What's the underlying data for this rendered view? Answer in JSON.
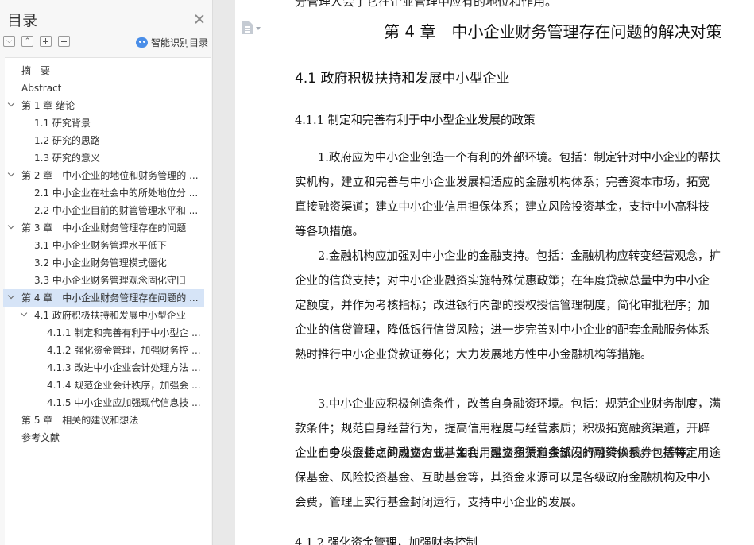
{
  "sidebar": {
    "title": "目录",
    "smart_label": "智能识别目录",
    "toc": [
      {
        "label": "摘　要",
        "level": 0,
        "expandable": false
      },
      {
        "label": "Abstract",
        "level": 0,
        "expandable": false
      },
      {
        "label": "第 1 章  绪论",
        "level": 0,
        "expandable": true
      },
      {
        "label": "1.1 研究背景",
        "level": 1,
        "expandable": false
      },
      {
        "label": "1.2 研究的思路",
        "level": 1,
        "expandable": false
      },
      {
        "label": "1.3 研究的意义",
        "level": 1,
        "expandable": false
      },
      {
        "label": "第 2 章　中小企业的地位和财务管理的 ...",
        "level": 0,
        "expandable": true
      },
      {
        "label": "2.1 中小企业在社会中的所处地位分 ...",
        "level": 1,
        "expandable": false
      },
      {
        "label": "2.2 中小企业目前的财管管理水平和 ...",
        "level": 1,
        "expandable": false
      },
      {
        "label": "第 3 章　中小企业财务管理存在的问题",
        "level": 0,
        "expandable": true
      },
      {
        "label": "3.1 中小企业财务管理水平低下",
        "level": 1,
        "expandable": false
      },
      {
        "label": "3.2 中小企业财务管理模式僵化",
        "level": 1,
        "expandable": false
      },
      {
        "label": "3.3 中小企业财务管理观念固化守旧",
        "level": 1,
        "expandable": false
      },
      {
        "label": "第 4 章　中小企业财务管理存在问题的 ...",
        "level": 0,
        "expandable": true,
        "selected": true
      },
      {
        "label": "4.1 政府积极扶持和发展中小型企业",
        "level": 1,
        "expandable": true
      },
      {
        "label": "4.1.1 制定和完善有利于中小型企 ...",
        "level": 2,
        "expandable": false
      },
      {
        "label": "4.1.2 强化资金管理，加强财务控 ...",
        "level": 2,
        "expandable": false
      },
      {
        "label": "4.1.3 改进中小企业会计处理方法 ...",
        "level": 2,
        "expandable": false
      },
      {
        "label": "4.1.4  规范企业会计秩序，加强会 ...",
        "level": 2,
        "expandable": false
      },
      {
        "label": "4.1.5 中小企业应加强现代信息技 ...",
        "level": 2,
        "expandable": false
      },
      {
        "label": "第 5 章　相关的建议和想法",
        "level": 0,
        "expandable": false
      },
      {
        "label": "参考文献",
        "level": 0,
        "expandable": false
      }
    ]
  },
  "document": {
    "top_cut_line": "分管理人会了它在企业管理中应有的地位和作用。",
    "chapter_title": "第 4 章　中小企业财务管理存在问题的解决对策",
    "section_title": "4.1 政府积极扶持和发展中小型企业",
    "subsection_title": "4.1.1 制定和完善有利于中小型企业发展的政策",
    "paragraphs": [
      [
        "1.政府应为中小企业创造一个有利的外部环境。包括：制定针对中小企业的帮扶",
        "实机构，建立和完善与中小企业发展相适应的金融机构体系；完善资本市场，拓宽",
        "直接融资渠道；建立中小企业信用担保体系；建立风险投资基金，支持中小高科技",
        "等各项措施。"
      ],
      [
        "2.金融机构应加强对中小企业的金融支持。包括：金融机构应转变经营观念，扩",
        "企业的信贷支持；对中小企业融资实施特殊优惠政策；在年度贷款总量中为中小企",
        "定额度，并作为考核指标；改进银行内部的授权授信管理制度，简化审批程序；加",
        "企业的信贷管理，降低银行信贷风险；进一步完善对中小企业的配套金融服务体系",
        "熟时推行中小企业贷款证券化；大力发展地方性中小金融机构等措施。"
      ],
      [
        "3.中小企业应积极创造条件，改善自身融资环境。包括：规范企业财务制度，满",
        "款条件；规范自身经营行为，提高信用程度与经营素质；积极拓宽融资渠道，开辟",
        "企业自身发展特点的融资方式，如利用融资租赁和尝试发行可转换债券，等等。"
      ],
      [
        "4.中小企业之间成立企业基金会，建立多渠道多部门的融资体系。包括特定用途",
        "保基金、风险投资基金、互助基金等，其资金来源可以是各级政府金融机构及中小",
        "会费，管理上实行基金封闭运行，支持中小企业的发展。"
      ]
    ],
    "next_subsection_title": "4.1.2 强化资金管理，加强财务控制"
  }
}
